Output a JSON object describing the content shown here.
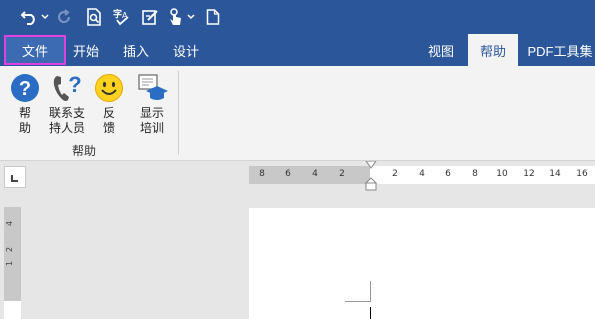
{
  "quick_access": {
    "undo_icon": "undo-icon",
    "redo_icon": "redo-icon",
    "print_preview_icon": "print-preview-icon",
    "spelling_icon": "spelling-icon",
    "edit_icon": "edit-document-icon",
    "touch_mode_icon": "touch-mode-icon",
    "new_document_icon": "new-document-icon"
  },
  "tabs": {
    "file": "文件",
    "home": "开始",
    "insert": "插入",
    "design": "设计",
    "view": "视图",
    "help": "帮助",
    "pdf": "PDF工具集"
  },
  "ribbon": {
    "buttons": [
      {
        "label": "帮\n助",
        "icon": "help-icon"
      },
      {
        "label": "联系支\n持人员",
        "icon": "contact-support-icon"
      },
      {
        "label": "反\n馈",
        "icon": "feedback-smiley-icon"
      },
      {
        "label": "显示\n培训",
        "icon": "show-training-icon"
      }
    ],
    "group_label": "帮助"
  },
  "ruler": {
    "numbers": [
      "8",
      "6",
      "4",
      "2",
      "2",
      "4",
      "6",
      "8",
      "10",
      "12",
      "14",
      "16"
    ],
    "vertical_numbers": [
      "4",
      "2",
      "1"
    ]
  },
  "colors": {
    "brand": "#2b579a",
    "file_highlight": "#e040e0"
  }
}
